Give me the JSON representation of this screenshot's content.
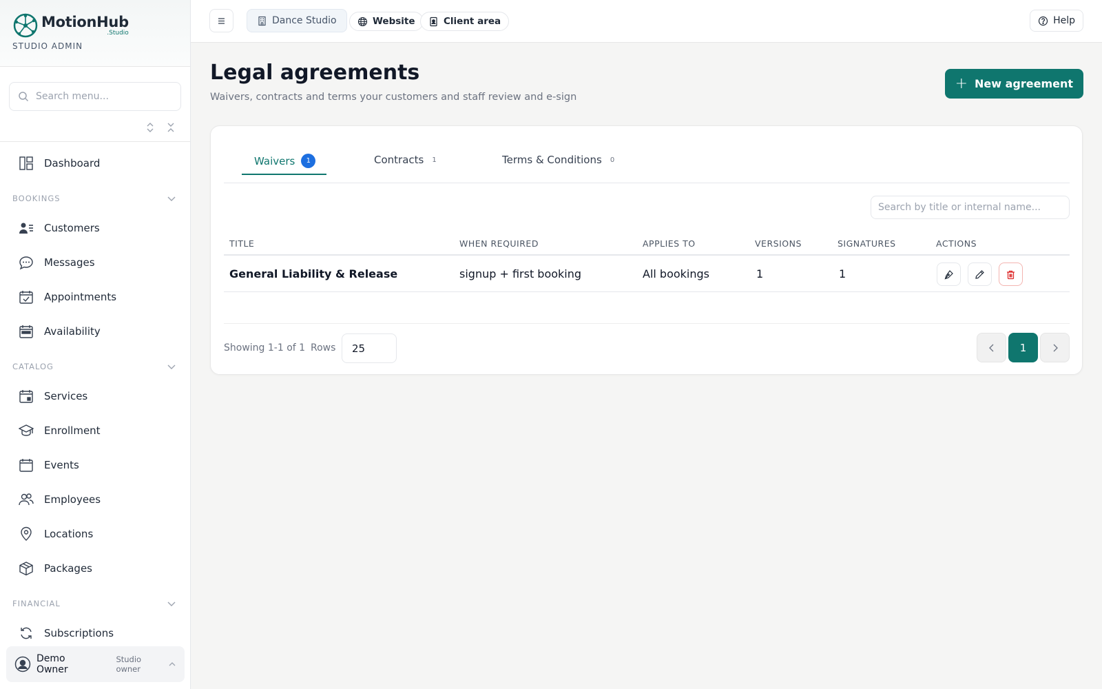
{
  "brand": {
    "name_a": "Motion",
    "name_b": "Hub",
    "sub": ".Studio",
    "role": "STUDIO ADMIN"
  },
  "menu_search": {
    "placeholder": "Search menu..."
  },
  "nav": {
    "dashboard": "Dashboard",
    "bookings": {
      "title": "BOOKINGS",
      "items": [
        "Customers",
        "Messages",
        "Appointments",
        "Availability"
      ]
    },
    "catalog": {
      "title": "CATALOG",
      "items": [
        "Services",
        "Enrollment",
        "Events",
        "Employees",
        "Locations",
        "Packages"
      ]
    },
    "financial": {
      "title": "FINANCIAL",
      "items": [
        "Subscriptions"
      ]
    }
  },
  "user": {
    "name": "Demo Owner",
    "role": "Studio owner"
  },
  "topbar": {
    "studio": "Dance Studio",
    "website": "Website",
    "client_area": "Client area",
    "help": "Help"
  },
  "page": {
    "title": "Legal agreements",
    "subtitle": "Waivers, contracts and terms your customers and staff review and e-sign",
    "new_button": "New agreement"
  },
  "tabs": [
    {
      "label": "Waivers",
      "count": "1"
    },
    {
      "label": "Contracts",
      "count": "1"
    },
    {
      "label": "Terms & Conditions",
      "count": "0"
    }
  ],
  "table": {
    "search_placeholder": "Search by title or internal name...",
    "headers": [
      "TITLE",
      "WHEN REQUIRED",
      "APPLIES TO",
      "VERSIONS",
      "SIGNATURES",
      "ACTIONS"
    ],
    "rows": [
      {
        "title": "General Liability & Release",
        "when": "signup + first booking",
        "applies": "All bookings",
        "versions": "1",
        "signatures": "1"
      }
    ]
  },
  "pagination": {
    "showing": "Showing 1-1 of 1",
    "rows_label": "Rows",
    "rows_value": "25",
    "current_page": "1"
  },
  "colors": {
    "accent": "#0f766e",
    "badge": "#1d6fe0",
    "danger": "#dc2626"
  }
}
